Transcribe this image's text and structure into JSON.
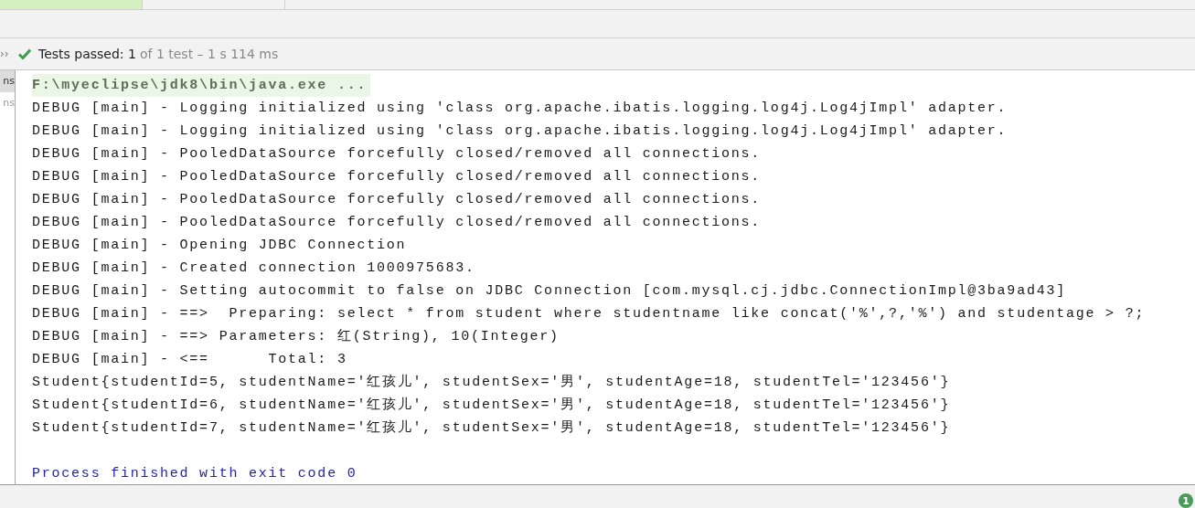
{
  "tabs": [
    {
      "selected": true
    },
    {
      "selected": false
    }
  ],
  "status": {
    "passed": "Tests passed: 1",
    "detail": "of 1 test – 1 s 114 ms",
    "chevron": "››"
  },
  "sidebar": {
    "items": [
      {
        "label": "ns",
        "selected": true
      },
      {
        "label": "ns",
        "selected": false
      }
    ]
  },
  "console": {
    "lines": [
      {
        "kind": "command",
        "text": "F:\\myeclipse\\jdk8\\bin\\java.exe ..."
      },
      {
        "kind": "log",
        "text": "DEBUG [main] - Logging initialized using 'class org.apache.ibatis.logging.log4j.Log4jImpl' adapter."
      },
      {
        "kind": "log",
        "text": "DEBUG [main] - Logging initialized using 'class org.apache.ibatis.logging.log4j.Log4jImpl' adapter."
      },
      {
        "kind": "log",
        "text": "DEBUG [main] - PooledDataSource forcefully closed/removed all connections."
      },
      {
        "kind": "log",
        "text": "DEBUG [main] - PooledDataSource forcefully closed/removed all connections."
      },
      {
        "kind": "log",
        "text": "DEBUG [main] - PooledDataSource forcefully closed/removed all connections."
      },
      {
        "kind": "log",
        "text": "DEBUG [main] - PooledDataSource forcefully closed/removed all connections."
      },
      {
        "kind": "log",
        "text": "DEBUG [main] - Opening JDBC Connection"
      },
      {
        "kind": "log",
        "text": "DEBUG [main] - Created connection 1000975683."
      },
      {
        "kind": "log",
        "text": "DEBUG [main] - Setting autocommit to false on JDBC Connection [com.mysql.cj.jdbc.ConnectionImpl@3ba9ad43]"
      },
      {
        "kind": "log",
        "text": "DEBUG [main] - ==>  Preparing: select * from student where studentname like concat('%',?,'%') and studentage > ?;"
      },
      {
        "kind": "log",
        "text": "DEBUG [main] - ==> Parameters: 红(String), 10(Integer)"
      },
      {
        "kind": "log",
        "text": "DEBUG [main] - <==      Total: 3"
      },
      {
        "kind": "log",
        "text": "Student{studentId=5, studentName='红孩儿', studentSex='男', studentAge=18, studentTel='123456'}"
      },
      {
        "kind": "log",
        "text": "Student{studentId=6, studentName='红孩儿', studentSex='男', studentAge=18, studentTel='123456'}"
      },
      {
        "kind": "log",
        "text": "Student{studentId=7, studentName='红孩儿', studentSex='男', studentAge=18, studentTel='123456'}"
      },
      {
        "kind": "exit",
        "text": "Process finished with exit code 0"
      }
    ]
  },
  "notification_badge": "1"
}
